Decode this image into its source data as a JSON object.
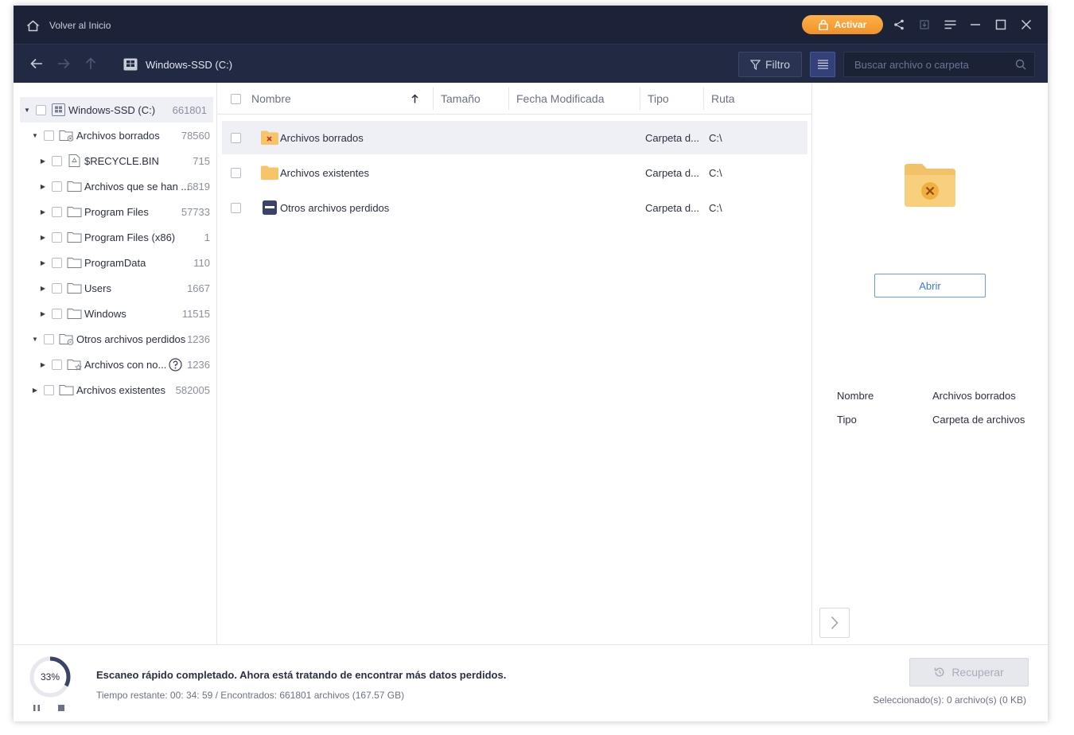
{
  "titlebar": {
    "home_label": "Volver al Inicio",
    "activate_label": "Activar",
    "accent": "#f0922a"
  },
  "navbar": {
    "drive_label": "Windows-SSD (C:)",
    "filter_label": "Filtro",
    "search_placeholder": "Buscar archivo o carpeta"
  },
  "tree": {
    "items": [
      {
        "label": "Windows-SSD (C:)",
        "count": "661801",
        "icon": "drive-icon",
        "level": 0,
        "arrow": "down"
      },
      {
        "label": "Archivos borrados",
        "count": "78560",
        "icon": "deleted-folder-icon",
        "level": 1,
        "arrow": "down"
      },
      {
        "label": "$RECYCLE.BIN",
        "count": "715",
        "icon": "recycle-file-icon",
        "level": 2,
        "arrow": "right"
      },
      {
        "label": "Archivos que se han ...",
        "count": "6819",
        "icon": "folder-icon",
        "level": 2,
        "arrow": "right"
      },
      {
        "label": "Program Files",
        "count": "57733",
        "icon": "folder-icon",
        "level": 2,
        "arrow": "right"
      },
      {
        "label": "Program Files (x86)",
        "count": "1",
        "icon": "folder-icon",
        "level": 2,
        "arrow": "right"
      },
      {
        "label": "ProgramData",
        "count": "110",
        "icon": "folder-icon",
        "level": 2,
        "arrow": "right"
      },
      {
        "label": "Users",
        "count": "1667",
        "icon": "folder-icon",
        "level": 2,
        "arrow": "right"
      },
      {
        "label": "Windows",
        "count": "11515",
        "icon": "folder-icon",
        "level": 2,
        "arrow": "right"
      },
      {
        "label": "Otros archivos perdidos",
        "count": "1236",
        "icon": "lost-folder-icon",
        "level": 1,
        "arrow": "down"
      },
      {
        "label": "Archivos con no...",
        "count": "1236",
        "icon": "tagged-folder-icon",
        "level": 2,
        "arrow": "right"
      },
      {
        "label": "Archivos existentes",
        "count": "582005",
        "icon": "folder-icon",
        "level": 1,
        "arrow": "right"
      }
    ]
  },
  "list": {
    "columns": [
      "Nombre",
      "Tamaño",
      "Fecha Modificada",
      "Tipo",
      "Ruta"
    ],
    "rows": [
      {
        "name": "Archivos borrados",
        "type": "Carpeta d...",
        "path": "C:\\"
      },
      {
        "name": "Archivos existentes",
        "type": "Carpeta d...",
        "path": "C:\\"
      },
      {
        "name": "Otros archivos perdidos",
        "type": "Carpeta d...",
        "path": "C:\\"
      }
    ]
  },
  "preview": {
    "open_label": "Abrir",
    "name_key": "Nombre",
    "name_value": "Archivos borrados",
    "type_key": "Tipo",
    "type_value": "Carpeta de archivos"
  },
  "bottom": {
    "progress_label": "33%",
    "progress_value": 0.33,
    "status_main": "Escaneo rápido completado. Ahora está tratando de encontrar más datos perdidos.",
    "status_sub": "Tiempo restante: 00: 34: 59 / Encontrados: 661801 archivos (167.57 GB)",
    "recover_label": "Recuperar",
    "selected_info": "Seleccionado(s): 0 archivo(s) (0 KB)"
  }
}
